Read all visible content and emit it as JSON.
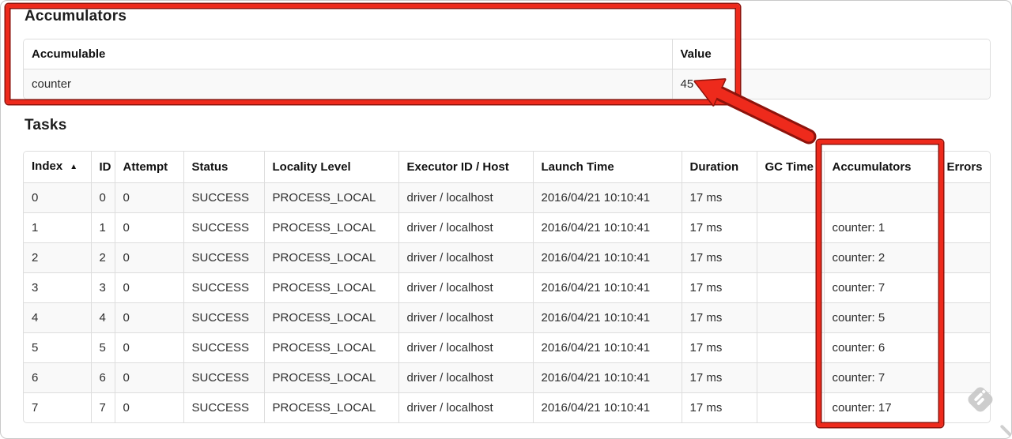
{
  "accumulators_section": {
    "title": "Accumulators",
    "table": {
      "headers": [
        "Accumulable",
        "Value"
      ],
      "rows": [
        {
          "accumulable": "counter",
          "value": "45"
        }
      ]
    }
  },
  "tasks_section": {
    "title": "Tasks",
    "table": {
      "headers": [
        "Index",
        "ID",
        "Attempt",
        "Status",
        "Locality Level",
        "Executor ID / Host",
        "Launch Time",
        "Duration",
        "GC Time",
        "Accumulators",
        "Errors"
      ],
      "sort": {
        "column": "Index",
        "direction": "ascending",
        "indicator": "▲"
      },
      "rows": [
        [
          "0",
          "0",
          "0",
          "SUCCESS",
          "PROCESS_LOCAL",
          "driver / localhost",
          "2016/04/21 10:10:41",
          "17 ms",
          "",
          "",
          ""
        ],
        [
          "1",
          "1",
          "0",
          "SUCCESS",
          "PROCESS_LOCAL",
          "driver / localhost",
          "2016/04/21 10:10:41",
          "17 ms",
          "",
          "counter: 1",
          ""
        ],
        [
          "2",
          "2",
          "0",
          "SUCCESS",
          "PROCESS_LOCAL",
          "driver / localhost",
          "2016/04/21 10:10:41",
          "17 ms",
          "",
          "counter: 2",
          ""
        ],
        [
          "3",
          "3",
          "0",
          "SUCCESS",
          "PROCESS_LOCAL",
          "driver / localhost",
          "2016/04/21 10:10:41",
          "17 ms",
          "",
          "counter: 7",
          ""
        ],
        [
          "4",
          "4",
          "0",
          "SUCCESS",
          "PROCESS_LOCAL",
          "driver / localhost",
          "2016/04/21 10:10:41",
          "17 ms",
          "",
          "counter: 5",
          ""
        ],
        [
          "5",
          "5",
          "0",
          "SUCCESS",
          "PROCESS_LOCAL",
          "driver / localhost",
          "2016/04/21 10:10:41",
          "17 ms",
          "",
          "counter: 6",
          ""
        ],
        [
          "6",
          "6",
          "0",
          "SUCCESS",
          "PROCESS_LOCAL",
          "driver / localhost",
          "2016/04/21 10:10:41",
          "17 ms",
          "",
          "counter: 7",
          ""
        ],
        [
          "7",
          "7",
          "0",
          "SUCCESS",
          "PROCESS_LOCAL",
          "driver / localhost",
          "2016/04/21 10:10:41",
          "17 ms",
          "",
          "counter: 17",
          ""
        ]
      ]
    }
  },
  "annotations": {
    "highlight_color": "#ee2a1c",
    "outline_color": "#8e130c",
    "watermark_color": "#c5c5c5"
  }
}
